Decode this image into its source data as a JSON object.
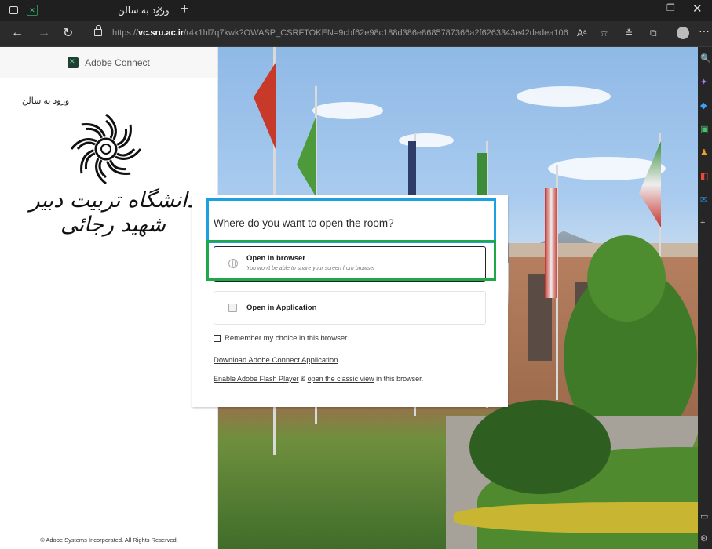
{
  "browser": {
    "tab_title": "ورود به سالن",
    "tab_close": "×",
    "new_tab": "+",
    "url_prefix": "https://",
    "url_host": "vc.sru.ac.ir",
    "url_rest": "/r4x1hl7q7kwk?OWASP_CSRFTOKEN=9cbf62e98c188d386e8685787366a2f6263343e42dedea106a0afee0478790a...",
    "icons": [
      "back-icon",
      "forward-icon",
      "reload-icon",
      "lock-icon",
      "read-aloud-icon",
      "favorite-icon",
      "favorites-icon",
      "collections-icon",
      "profile-icon",
      "more-icon"
    ]
  },
  "left_panel": {
    "brand": "Adobe Connect",
    "room_name": "ورود به سالن",
    "university_name": "دانشگاه تربیت دبیر شهید رجائی",
    "copyright": "© Adobe Systems Incorporated. All Rights Reserved."
  },
  "dialog": {
    "title": "Where do you want to open the room?",
    "option_browser_label": "Open in browser",
    "option_browser_sub": "You won't be able to share your screen from browser",
    "option_app_label": "Open in Application",
    "remember_label": "Remember my choice in this browser",
    "download_link": "Download Adobe Connect Application",
    "flash_link": "Enable Adobe Flash Player",
    "and_text": " & ",
    "classic_link": "open the classic view",
    "tail_text": " in this browser."
  },
  "colors": {
    "highlight_blue": "#1ba1e2",
    "highlight_green": "#1fa84a",
    "chrome_bg": "#1f1f1f"
  }
}
